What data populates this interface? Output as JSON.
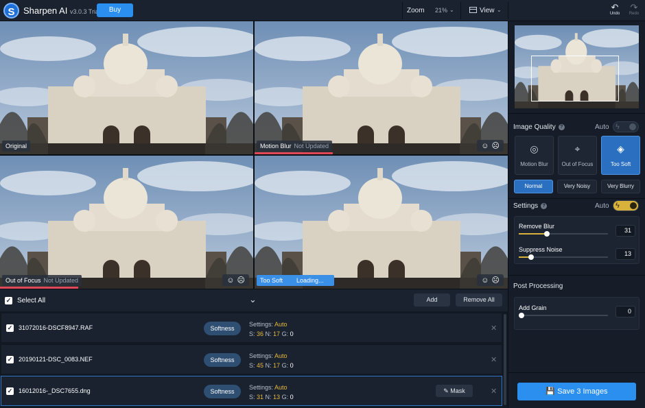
{
  "app": {
    "logo_letter": "S",
    "name": "Sharpen AI",
    "version": "v3.0.3 Trial",
    "buy_label": "Buy"
  },
  "toolbar": {
    "zoom_label": "Zoom",
    "zoom_value": "21%",
    "view_label": "View",
    "undo_label": "Undo",
    "redo_label": "Redo"
  },
  "previews": [
    {
      "label": "Original",
      "status": ""
    },
    {
      "label": "Motion Blur",
      "status": "Not Updated",
      "progress": 0.31
    },
    {
      "label": "Out of Focus",
      "status": "Not Updated",
      "progress": 0.31
    },
    {
      "label": "Too Soft",
      "status": "Loading..."
    }
  ],
  "selection": {
    "select_all_label": "Select All",
    "add_label": "Add",
    "remove_all_label": "Remove All"
  },
  "files": [
    {
      "name": "31072016-DSCF8947.RAF",
      "model": "Softness",
      "settings_label": "Settings:",
      "settings_mode": "Auto",
      "s": "36",
      "n": "17",
      "g": "0"
    },
    {
      "name": "20190121-DSC_0083.NEF",
      "model": "Softness",
      "settings_label": "Settings:",
      "settings_mode": "Auto",
      "s": "45",
      "n": "17",
      "g": "0"
    },
    {
      "name": "16012016-_DSC7655.dng",
      "model": "Softness",
      "settings_label": "Settings:",
      "settings_mode": "Auto",
      "s": "31",
      "n": "13",
      "g": "0",
      "mask_label": "Mask"
    }
  ],
  "panel": {
    "image_quality_title": "Image Quality",
    "auto_label": "Auto",
    "models": [
      {
        "label": "Motion Blur",
        "icon": "camera-shake-icon"
      },
      {
        "label": "Out of Focus",
        "icon": "focus-icon"
      },
      {
        "label": "Too Soft",
        "icon": "soft-icon",
        "active": true
      }
    ],
    "noise_levels": [
      "Normal",
      "Very Noisy",
      "Very Blurry"
    ],
    "settings_title": "Settings",
    "settings_auto_label": "Auto",
    "remove_blur_label": "Remove Blur",
    "remove_blur_value": "31",
    "suppress_noise_label": "Suppress Noise",
    "suppress_noise_value": "13",
    "post_processing_title": "Post Processing",
    "add_grain_label": "Add Grain",
    "add_grain_value": "0",
    "save_label": "Save 3 Images"
  },
  "colors": {
    "accent": "#2b8ff0",
    "active_model": "#2a6fc0",
    "slider_fill": "#d9b23c",
    "progress": "#e0485a"
  }
}
